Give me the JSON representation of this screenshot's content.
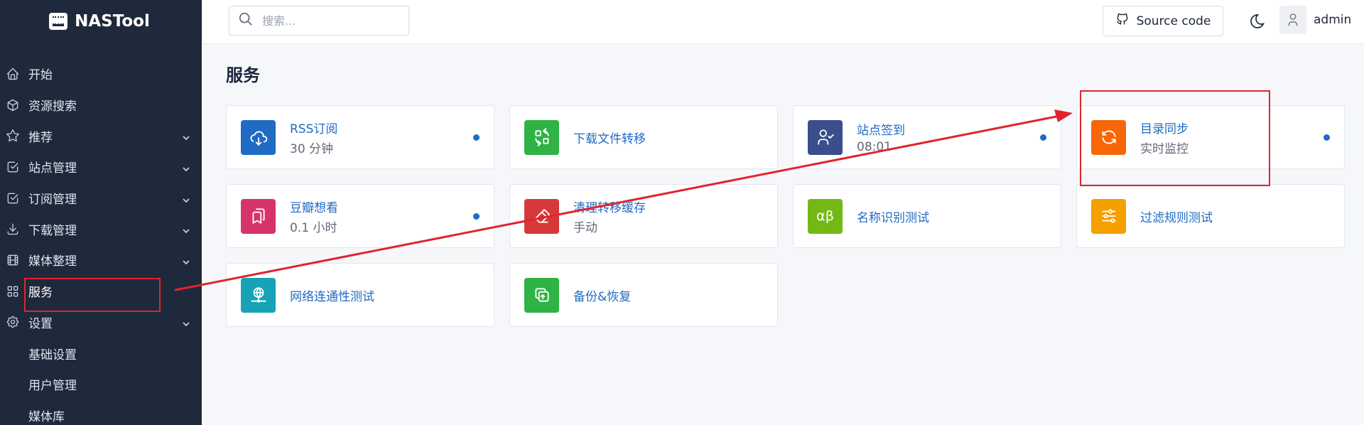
{
  "app": {
    "title": "NASTool"
  },
  "search": {
    "placeholder": "搜索..."
  },
  "topbar": {
    "source_label": "Source code",
    "username": "admin"
  },
  "sidebar": {
    "items": [
      {
        "label": "开始",
        "icon": "home-icon",
        "chevron": false
      },
      {
        "label": "资源搜索",
        "icon": "cube-icon",
        "chevron": false
      },
      {
        "label": "推荐",
        "icon": "star-icon",
        "chevron": true
      },
      {
        "label": "站点管理",
        "icon": "checkbox-icon",
        "chevron": true
      },
      {
        "label": "订阅管理",
        "icon": "checkbox-icon",
        "chevron": true
      },
      {
        "label": "下载管理",
        "icon": "download-icon",
        "chevron": true
      },
      {
        "label": "媒体整理",
        "icon": "film-icon",
        "chevron": true
      },
      {
        "label": "服务",
        "icon": "apps-icon",
        "chevron": false,
        "active": true
      },
      {
        "label": "设置",
        "icon": "gear-icon",
        "chevron": true,
        "expanded": true
      }
    ],
    "subitems": [
      {
        "label": "基础设置"
      },
      {
        "label": "用户管理"
      },
      {
        "label": "媒体库"
      }
    ]
  },
  "main": {
    "title": "服务",
    "cards": [
      {
        "title": "RSS订阅",
        "subtitle": "30 分钟",
        "color": "#206bc4",
        "icon": "cloud-download-icon",
        "dot": true
      },
      {
        "title": "下载文件转移",
        "subtitle": "",
        "color": "#2fb344",
        "icon": "transfer-icon",
        "dot": false
      },
      {
        "title": "站点签到",
        "subtitle": "08:01",
        "color": "#3a4d8c",
        "icon": "user-check-icon",
        "dot": true
      },
      {
        "title": "目录同步",
        "subtitle": "实时监控",
        "color": "#f76707",
        "icon": "refresh-icon",
        "dot": true
      },
      {
        "title": "豆瓣想看",
        "subtitle": "0.1 小时",
        "color": "#d6336c",
        "icon": "bookmarks-icon",
        "dot": true
      },
      {
        "title": "清理转移缓存",
        "subtitle": "手动",
        "color": "#d63939",
        "icon": "eraser-icon",
        "dot": false
      },
      {
        "title": "名称识别测试",
        "subtitle": "",
        "color": "#74b816",
        "icon": "alpha-beta-icon",
        "icon_text": "αβ",
        "dot": false
      },
      {
        "title": "过滤规则测试",
        "subtitle": "",
        "color": "#f59f00",
        "icon": "adjustments-icon",
        "dot": false
      },
      {
        "title": "网络连通性测试",
        "subtitle": "",
        "color": "#17a2b8",
        "icon": "network-icon",
        "dot": false
      },
      {
        "title": "备份&恢复",
        "subtitle": "",
        "color": "#2fb344",
        "icon": "copy-icon",
        "dot": false
      }
    ]
  },
  "annotation": {
    "color": "#e0242f"
  }
}
